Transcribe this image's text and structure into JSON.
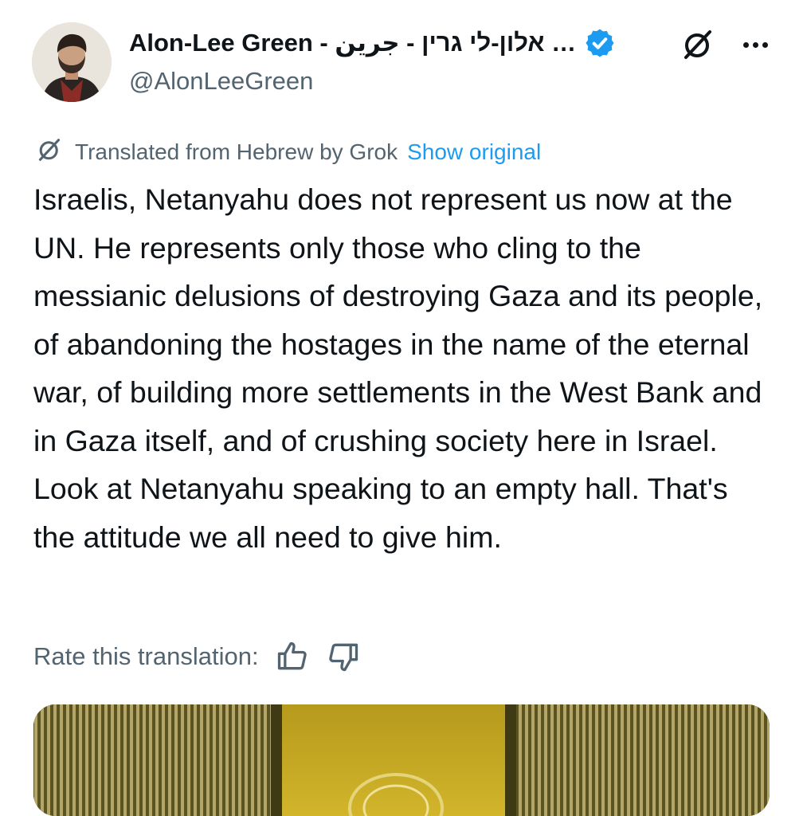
{
  "tweet": {
    "author": {
      "display_name": "Alon-Lee Green - אלון-לי גרין - جرين …",
      "handle": "@AlonLeeGreen",
      "verified": true
    },
    "translation": {
      "notice": "Translated from Hebrew by Grok",
      "show_original_label": "Show original"
    },
    "text": "Israelis, Netanyahu does not represent us now at the UN. He represents only those who cling to the messianic delusions of destroying Gaza and its people, of abandoning the hostages in the name of the eternal war, of building more settlements in the West Bank and in Gaza itself, and of crushing society here in Israel. Look at Netanyahu speaking to an empty hall. That's the attitude we all need to give him.",
    "rate_translation_label": "Rate this translation:"
  },
  "icons": {
    "verified": "verified-badge-icon",
    "grok": "grok-icon",
    "more": "more-icon",
    "thumbs_up": "thumbs-up-icon",
    "thumbs_down": "thumbs-down-icon"
  },
  "colors": {
    "text_primary": "#0f1419",
    "text_secondary": "#536471",
    "accent_blue": "#1d9bf0"
  }
}
